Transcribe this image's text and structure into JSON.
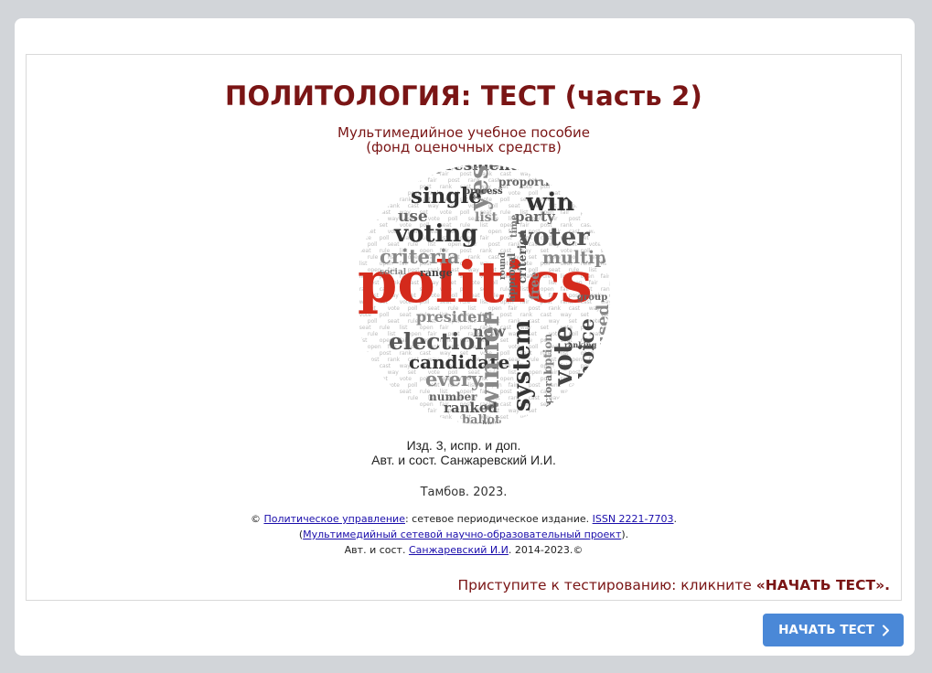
{
  "page": {
    "title": "ПОЛИТОЛОГИЯ: ТЕСТ (часть 2)",
    "subtitle_line1": "Мультимедийное учебное пособие",
    "subtitle_line2": "(фонд оценочных средств)"
  },
  "word_cloud": {
    "words": [
      {
        "t": "politics",
        "c": "#d42a1c"
      },
      {
        "t": "presidential",
        "c": "#555"
      },
      {
        "t": "proportional",
        "c": "#666"
      },
      {
        "t": "single",
        "c": "#333"
      },
      {
        "t": "yes",
        "c": "#888"
      },
      {
        "t": "win",
        "c": "#333"
      },
      {
        "t": "use",
        "c": "#666"
      },
      {
        "t": "list",
        "c": "#888"
      },
      {
        "t": "party",
        "c": "#666"
      },
      {
        "t": "voting",
        "c": "#333"
      },
      {
        "t": "voter",
        "c": "#555"
      },
      {
        "t": "criteria",
        "c": "#888"
      },
      {
        "t": "multiple",
        "c": "#888"
      },
      {
        "t": "president",
        "c": "#888"
      },
      {
        "t": "new",
        "c": "#666"
      },
      {
        "t": "election",
        "c": "#555"
      },
      {
        "t": "candidate",
        "c": "#333"
      },
      {
        "t": "every",
        "c": "#888"
      },
      {
        "t": "winner",
        "c": "#888"
      },
      {
        "t": "system",
        "c": "#333"
      },
      {
        "t": "vote",
        "c": "#444"
      },
      {
        "t": "choice",
        "c": "#444"
      },
      {
        "t": "used",
        "c": "#888"
      },
      {
        "t": "number",
        "c": "#666"
      },
      {
        "t": "ranked",
        "c": "#555"
      },
      {
        "t": "ballot",
        "c": "#888"
      },
      {
        "t": "power",
        "c": "#666"
      },
      {
        "t": "free",
        "c": "#888"
      },
      {
        "t": "group",
        "c": "#666"
      },
      {
        "t": "range",
        "c": "#444"
      },
      {
        "t": "social",
        "c": "#888"
      },
      {
        "t": "round",
        "c": "#666"
      },
      {
        "t": "approval",
        "c": "#666"
      },
      {
        "t": "criterion",
        "c": "#555"
      },
      {
        "t": "process",
        "c": "#444"
      },
      {
        "t": "time",
        "c": "#777"
      },
      {
        "t": "electoral",
        "c": "#777"
      },
      {
        "t": "option",
        "c": "#888"
      },
      {
        "t": "rated",
        "c": "#888"
      },
      {
        "t": "ranking",
        "c": "#555"
      },
      {
        "t": "order",
        "c": "#555"
      },
      {
        "t": "local",
        "c": "#777"
      }
    ]
  },
  "info": {
    "edition": "Изд. 3, испр. и доп.",
    "authors": "Авт. и сост. Санжаревский И.И.",
    "city_year": "Тамбов. 2023."
  },
  "copyright": {
    "symbol": "©",
    "link_journal": "Политическое управление",
    "text_journal": ": сетевое периодическое издание.",
    "link_issn": "ISSN 2221-7703",
    "dot": ".",
    "open_paren": "(",
    "link_project": "Мультимедийный сетевой научно-образовательный проект",
    "close_paren": ").",
    "authors_prefix": "Авт. и сост.",
    "link_author": "Санжаревский И.И",
    "years": ". 2014-2023.©"
  },
  "cta": {
    "prefix": "Приступите к тестированию: кликните",
    "bold": "«НАЧАТЬ ТЕСТ»."
  },
  "start_button": {
    "label": "НАЧАТЬ ТЕСТ",
    "icon": "chevron-right-icon"
  },
  "colors": {
    "title": "#7a1515",
    "button": "#4a88d7",
    "link": "#1a0dab",
    "background": "#d2d5d9"
  }
}
